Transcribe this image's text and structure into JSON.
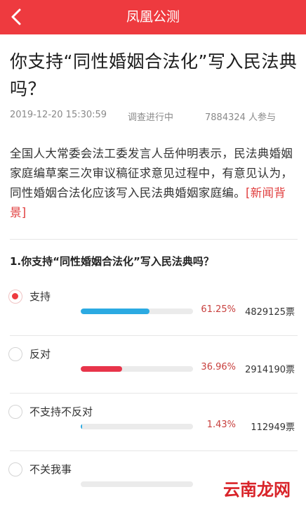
{
  "header": {
    "title": "凤凰公测",
    "bg_color": "#ee3a3f",
    "back_icon": "chevron-left-icon"
  },
  "question": {
    "title": "你支持“同性婚姻合法化”写入民法典吗？",
    "date": "2019-12-20 15:30:59",
    "status": "调查进行中",
    "participants": "7884324 人参与",
    "intro": "全国人大常委会法工委发言人岳仲明表示，民法典婚姻家庭编草案三次审议稿征求意见过程中，有意见认为，同性婚姻合法化应该写入民法典婚姻家庭编。",
    "intro_link": "[新闻背景]"
  },
  "poll": {
    "question": "1.你支持“同性婚姻合法化”写入民法典吗？",
    "options": [
      {
        "label": "支持",
        "percent": "61.25%",
        "votes": "4829125票",
        "fill": 0.6125,
        "color": "#2baae2",
        "selected": true
      },
      {
        "label": "反对",
        "percent": "36.96%",
        "votes": "2914190票",
        "fill": 0.3696,
        "color": "#e8344a",
        "selected": false
      },
      {
        "label": "不支持不反对",
        "percent": "1.43%",
        "votes": "112949票",
        "fill": 0.0143,
        "color": "#2baae2",
        "selected": false
      },
      {
        "label": "不关我事",
        "percent": "",
        "votes": "",
        "fill": 0,
        "color": "#2baae2",
        "selected": false
      }
    ]
  },
  "watermark": {
    "text": "云南龙网"
  }
}
